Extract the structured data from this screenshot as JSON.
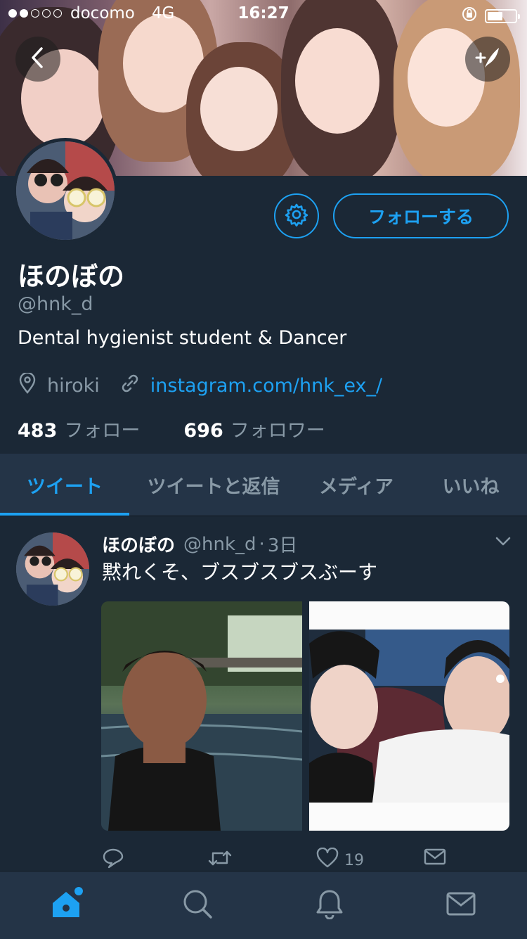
{
  "status_bar": {
    "carrier": "docomo",
    "network": "4G",
    "time": "16:27",
    "signal_bars": 2,
    "signal_max": 5,
    "battery_level": 0.55
  },
  "header": {
    "back_icon": "chevron-left-icon",
    "compose_icon": "compose-tweet-icon"
  },
  "profile": {
    "name": "ほのぼの",
    "handle": "@hnk_d",
    "bio": "Dental hygienist student & Dancer",
    "location": "hiroki",
    "website": "instagram.com/hnk_ex_/",
    "following_count": "483",
    "following_label": "フォロー",
    "followers_count": "696",
    "followers_label": "フォロワー",
    "follow_button": "フォローする",
    "settings_icon": "gear-icon"
  },
  "tabs": [
    {
      "label": "ツイート",
      "active": true
    },
    {
      "label": "ツイートと返信",
      "active": false
    },
    {
      "label": "メディア",
      "active": false
    },
    {
      "label": "いいね",
      "active": false
    }
  ],
  "tweet": {
    "name": "ほのぼの",
    "handle": "@hnk_d",
    "separator": "·",
    "time": "3日",
    "text": "黙れくそ、ブスブスブスぶーす",
    "like_count": "19"
  },
  "bottom_nav": [
    {
      "name": "home",
      "icon": "home-icon",
      "active": true
    },
    {
      "name": "search",
      "icon": "search-icon",
      "active": false
    },
    {
      "name": "notifications",
      "icon": "bell-icon",
      "active": false
    },
    {
      "name": "messages",
      "icon": "mail-icon",
      "active": false
    }
  ],
  "colors": {
    "background": "#1b2836",
    "bar": "#243447",
    "accent": "#1da1f2",
    "muted": "#8899a6"
  }
}
